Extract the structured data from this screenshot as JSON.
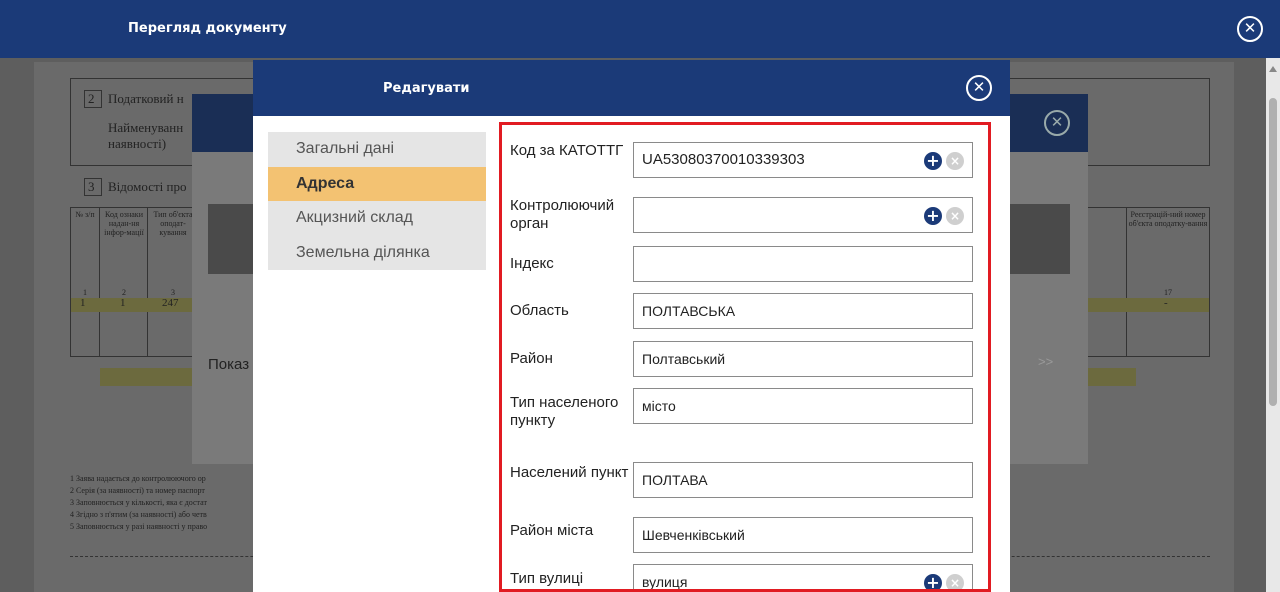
{
  "header": {
    "title": "Перегляд документу"
  },
  "background_doc": {
    "section2_label": "2",
    "section2_text": "Податковий н",
    "section2_name_line1": "Найменуванн",
    "section2_name_line2": "наявності)",
    "section3_label": "3",
    "section3_text": "Відомості про",
    "table_headers": [
      "№ з/п",
      "Код ознаки надан-ня інфор-мації",
      "Тип об'єкта оподат-кування",
      "Реєстрацій-ний номер об'єкта оподатку-вання"
    ],
    "table_numbers": [
      "1",
      "2",
      "3",
      "17"
    ],
    "table_row": [
      "1",
      "1",
      "247",
      "-"
    ],
    "footnotes": [
      "1   Заява надається до контролюючого ор",
      "2   Серія (за наявності) та номер паспорт",
      "3   Заповнюється у кількості, яка є достат",
      "4   Згідно з п'ятим (за наявності) або четв",
      "5   Заповнюється у разі наявності у право"
    ]
  },
  "middle_modal": {
    "show_label": "Показ",
    "next_label": ">>"
  },
  "modal": {
    "title": "Редагувати",
    "nav": [
      {
        "label": "Загальні дані",
        "active": false
      },
      {
        "label": "Адреса",
        "active": true
      },
      {
        "label": "Акцизний склад",
        "active": false
      },
      {
        "label": "Земельна ділянка",
        "active": false
      }
    ],
    "fields": [
      {
        "label": "Код за КАТОТТГ",
        "value": "UA53080370010339303",
        "has_add": true,
        "has_clear": true
      },
      {
        "label": "Контролюючий орган",
        "value": "",
        "has_add": true,
        "has_clear": true
      },
      {
        "label": "Індекс",
        "value": "",
        "has_add": false,
        "has_clear": false
      },
      {
        "label": "Область",
        "value": "ПОЛТАВСЬКА",
        "has_add": false,
        "has_clear": false
      },
      {
        "label": "Район",
        "value": "Полтавський",
        "has_add": false,
        "has_clear": false
      },
      {
        "label": "Тип населеного пункту",
        "value": "місто",
        "has_add": false,
        "has_clear": false
      },
      {
        "label": "Населений пункт",
        "value": "ПОЛТАВА",
        "has_add": false,
        "has_clear": false
      },
      {
        "label": "Район міста",
        "value": "Шевченківський",
        "has_add": false,
        "has_clear": false
      },
      {
        "label": "Тип вулиці",
        "value": "вулиця",
        "has_add": true,
        "has_clear": true
      }
    ]
  },
  "colors": {
    "header": "#1b3a78",
    "active_nav": "#f3c272",
    "highlight_border": "#e11b22",
    "arrow": "#e11b22"
  },
  "icons": {
    "close": "close-icon",
    "add": "plus-circle-icon",
    "clear": "x-circle-icon"
  }
}
